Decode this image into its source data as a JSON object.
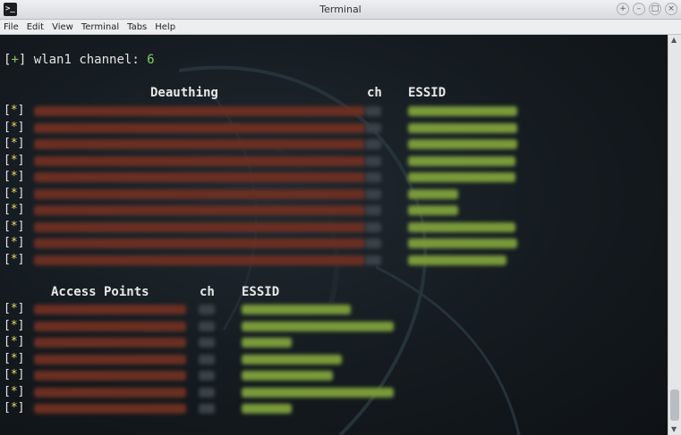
{
  "window": {
    "title": "Terminal",
    "icon": "terminal-icon",
    "controls": [
      "+",
      "–",
      "□",
      "×"
    ]
  },
  "menu": [
    "File",
    "Edit",
    "View",
    "Terminal",
    "Tabs",
    "Help"
  ],
  "terminal": {
    "channel_line": {
      "prefix_open": "[",
      "prefix_symbol": "+",
      "prefix_close": "]",
      "text": " wlan1 channel: ",
      "value": "6"
    },
    "deauth": {
      "header_left": "Deauthing",
      "header_ch": "ch",
      "header_essid": "ESSID",
      "marker": "[*]",
      "rows": 10
    },
    "access_points": {
      "header_left": "Access Points",
      "header_ch": "ch",
      "header_essid": "ESSID",
      "marker": "[*]",
      "rows": 7
    }
  },
  "colors": {
    "terminal_bg": "#141a1f",
    "text": "#e6e6e6",
    "green": "#7fd05a",
    "star_yellow": "#e8df5a"
  }
}
